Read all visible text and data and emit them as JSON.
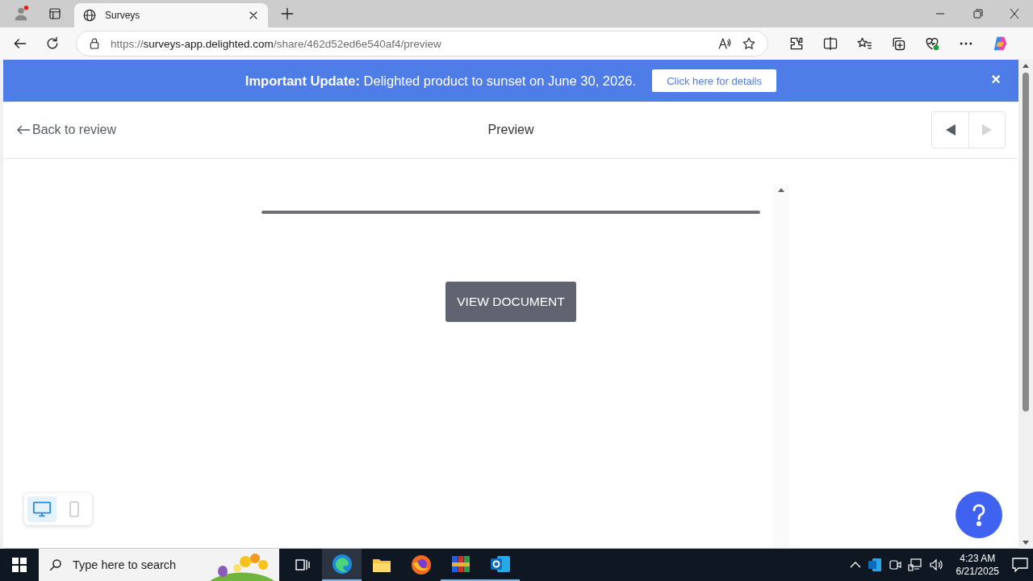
{
  "browser": {
    "tab": {
      "title": "Surveys"
    },
    "address": {
      "scheme": "https://",
      "host": "surveys-app.delighted.com",
      "path": "/share/462d52ed6e540af4/preview"
    }
  },
  "banner": {
    "lead": "Important Update:",
    "text": "Delighted product to sunset on June 30, 2026.",
    "button": "Click here for details",
    "close": "×"
  },
  "header": {
    "back": "Back to review",
    "title": "Preview",
    "nav": [
      {
        "kind": "prev",
        "disabled": false
      },
      {
        "kind": "next",
        "disabled": true
      }
    ]
  },
  "survey": {
    "progress": {
      "level": 0
    },
    "button": "VIEW DOCUMENT"
  },
  "devices": [
    {
      "kind": "desktop",
      "selected": true
    },
    {
      "kind": "mobile",
      "selected": false
    }
  ],
  "taskbar": {
    "search": {
      "placeholder": "Type here to search"
    },
    "time": "4:23 AM",
    "date": "6/21/2025"
  }
}
